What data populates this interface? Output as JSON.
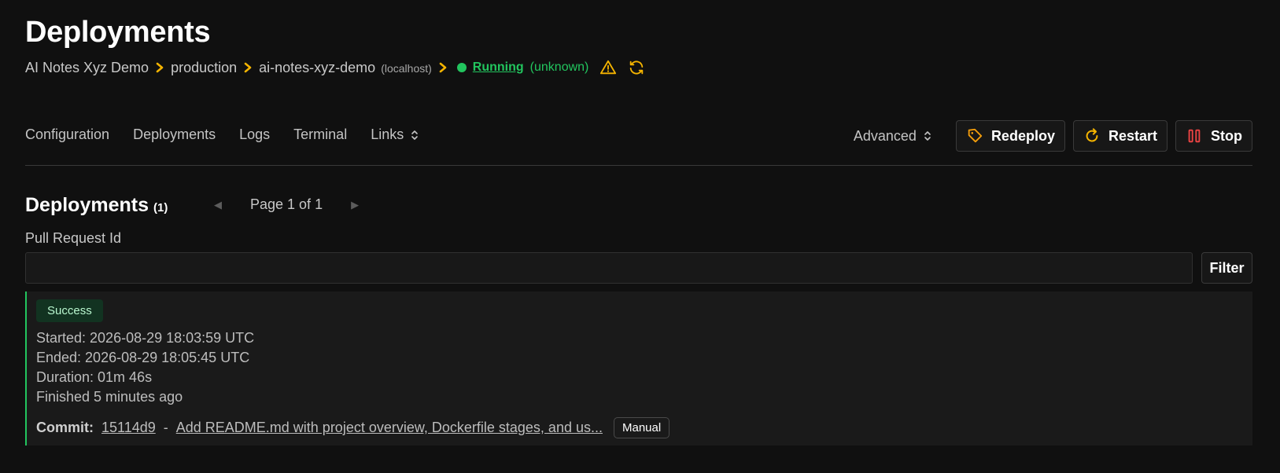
{
  "header": {
    "title": "Deployments"
  },
  "breadcrumb": {
    "project": "AI Notes Xyz Demo",
    "environment": "production",
    "application": "ai-notes-xyz-demo",
    "server": "(localhost)",
    "status_label": "Running",
    "status_detail": "(unknown)",
    "status_color": "#22c55e"
  },
  "nav": {
    "tabs": [
      "Configuration",
      "Deployments",
      "Logs",
      "Terminal",
      "Links"
    ],
    "advanced_label": "Advanced",
    "redeploy_label": "Redeploy",
    "restart_label": "Restart",
    "stop_label": "Stop"
  },
  "deployments": {
    "title": "Deployments",
    "count": "(1)",
    "page_label": "Page 1 of 1",
    "filter_label": "Pull Request Id",
    "filter_value": "",
    "filter_button": "Filter"
  },
  "deployment": {
    "status": "Success",
    "started": "Started: 2026-08-29 18:03:59 UTC",
    "ended": "Ended: 2026-08-29 18:05:45 UTC",
    "duration": "Duration: 01m 46s",
    "finished": "Finished 5 minutes ago",
    "commit_label": "Commit:",
    "commit_hash": "15114d9",
    "commit_separator": "-",
    "commit_message": "Add README.md with project overview, Dockerfile stages, and us...",
    "trigger": "Manual"
  },
  "colors": {
    "background": "#101010",
    "accent_yellow": "#f5b400",
    "accent_orange": "#f59e0b",
    "success_green": "#22c55e",
    "stop_red": "#ef4444"
  }
}
